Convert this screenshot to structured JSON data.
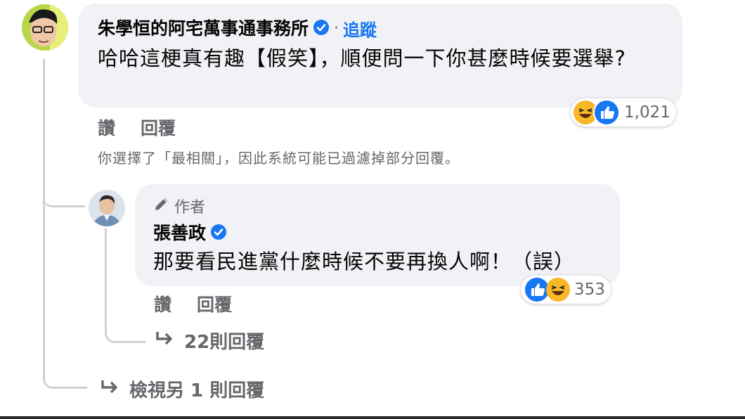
{
  "comment": {
    "author": "朱學恒的阿宅萬事通事務所",
    "separator": "·",
    "follow_label": "追蹤",
    "text": "哈哈這梗真有趣【假笑】，順便問一下你甚麼時候要選舉?",
    "actions": {
      "like": "讚",
      "reply": "回覆"
    },
    "reactions": {
      "icons": [
        "haha-icon",
        "like-icon"
      ],
      "count": "1,021"
    }
  },
  "filter_note": "你選擇了「最相關」，因此系統可能已過濾掉部分回覆。",
  "reply": {
    "badge": "作者",
    "author": "張善政",
    "text": "那要看民進黨什麼時候不要再換人啊！（誤）",
    "actions": {
      "like": "讚",
      "reply": "回覆"
    },
    "reactions": {
      "icons": [
        "like-icon",
        "haha-icon"
      ],
      "count": "353"
    },
    "more_replies": "22則回覆"
  },
  "view_more": "檢視另 1 則回覆",
  "colors": {
    "bubble": "#f0f2f5",
    "accent": "#1877f2",
    "muted": "#65676b",
    "line": "#ced0d4"
  }
}
